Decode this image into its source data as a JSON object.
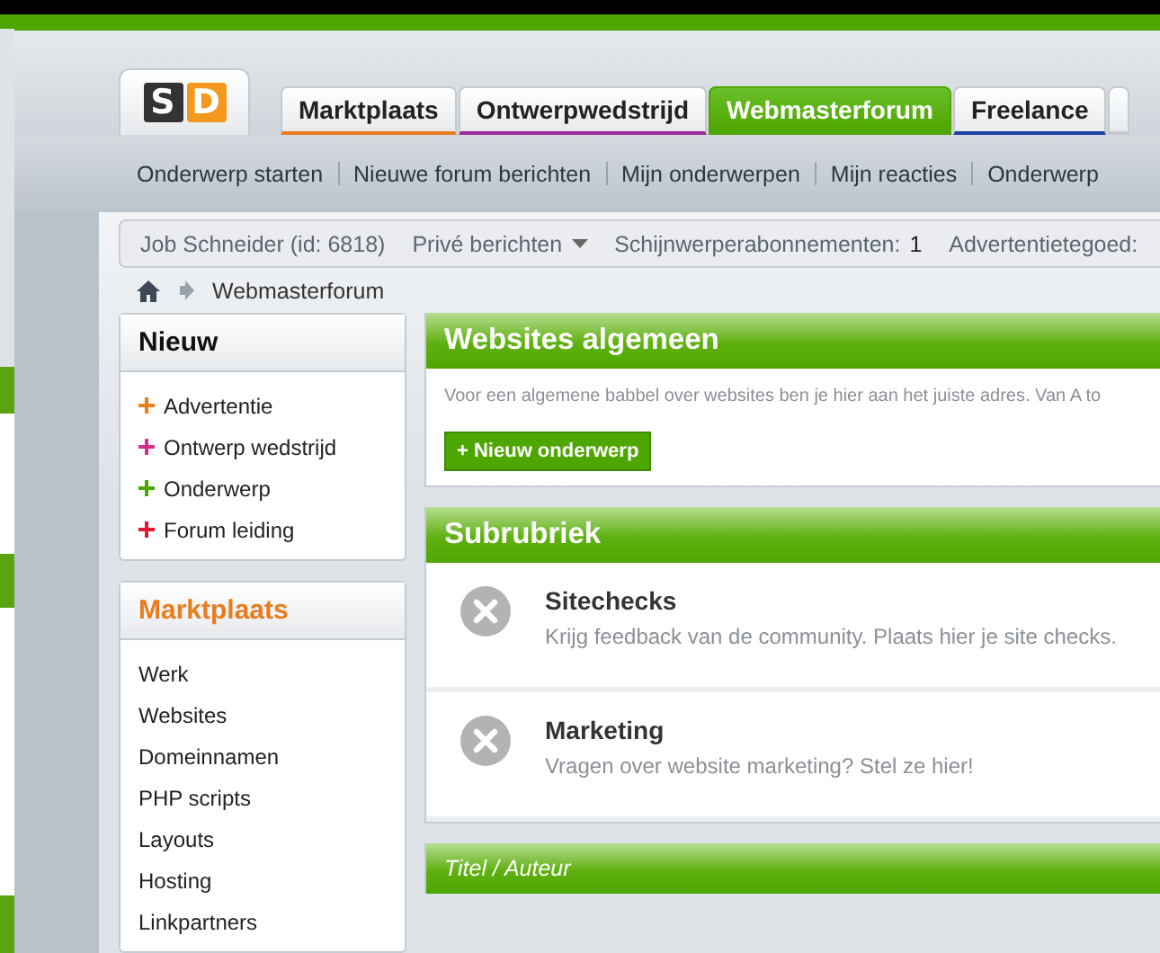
{
  "logo": {
    "letters": [
      "S",
      "D"
    ]
  },
  "tabs": [
    {
      "label": "Marktplaats",
      "selected": false,
      "color": "#e87c1e"
    },
    {
      "label": "Ontwerpwedstrijd",
      "selected": false,
      "color": "#9b2c9b"
    },
    {
      "label": "Webmasterforum",
      "selected": true,
      "color": "#4ea600"
    },
    {
      "label": "Freelance",
      "selected": false,
      "color": "#1f3f9e"
    }
  ],
  "nav": [
    "Onderwerp starten",
    "Nieuwe forum berichten",
    "Mijn onderwerpen",
    "Mijn reacties",
    "Onderwerp"
  ],
  "user_bar": {
    "user": "Job Schneider (id: 6818)",
    "messages": "Privé berichten",
    "subscriptions_label": "Schijnwerperabonnementen:",
    "subscriptions_count": "1",
    "credit_label": "Advertentietegoed:"
  },
  "breadcrumb": [
    "Webmasterforum"
  ],
  "sidebar": [
    {
      "title": "Nieuw",
      "kind": "new",
      "color": "#111111",
      "items": [
        {
          "label": "Advertentie",
          "color": "#e87c1e"
        },
        {
          "label": "Ontwerp wedstrijd",
          "color": "#d62f8a"
        },
        {
          "label": "Onderwerp",
          "color": "#4ea600"
        },
        {
          "label": "Forum leiding",
          "color": "#e0182d"
        }
      ]
    },
    {
      "title": "Marktplaats",
      "kind": "links",
      "color": "#e87c1e",
      "items": [
        {
          "label": "Werk"
        },
        {
          "label": "Websites"
        },
        {
          "label": "Domeinnamen"
        },
        {
          "label": "PHP scripts"
        },
        {
          "label": "Layouts"
        },
        {
          "label": "Hosting"
        },
        {
          "label": "Linkpartners"
        }
      ]
    }
  ],
  "forum": {
    "title": "Websites algemeen",
    "description": "Voor een algemene babbel over websites ben je hier aan het juiste adres. Van A to",
    "new_topic_button": "+ Nieuw onderwerp"
  },
  "subforums": {
    "title": "Subrubriek",
    "items": [
      {
        "title": "Sitechecks",
        "description": "Krijg feedback van de community. Plaats hier je site checks."
      },
      {
        "title": "Marketing",
        "description": "Vragen over website marketing? Stel ze hier!"
      }
    ]
  },
  "topics": {
    "columns": [
      "Titel / Auteur"
    ]
  }
}
